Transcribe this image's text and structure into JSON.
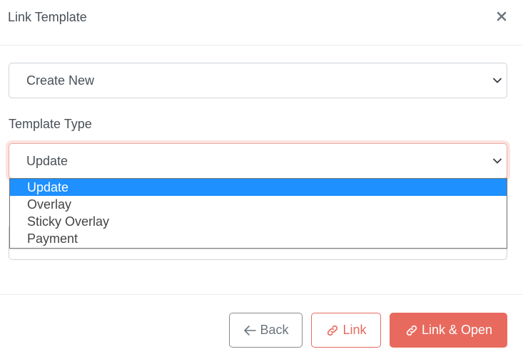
{
  "modal": {
    "title": "Link Template",
    "close_icon": "close-icon"
  },
  "create_select": {
    "value": "Create New"
  },
  "template_type": {
    "label": "Template Type",
    "value": "Update",
    "options": [
      "Update",
      "Overlay",
      "Sticky Overlay",
      "Payment"
    ],
    "selected_index": 0
  },
  "buttons": {
    "back": {
      "label": "Back",
      "icon": "arrow-left-icon"
    },
    "link": {
      "label": "Link",
      "icon": "link-icon"
    },
    "link_open": {
      "label": "Link & Open",
      "icon": "link-icon"
    }
  },
  "colors": {
    "accent": "#e86a5e",
    "selected_option": "#1e90ff",
    "text": "#495057"
  }
}
